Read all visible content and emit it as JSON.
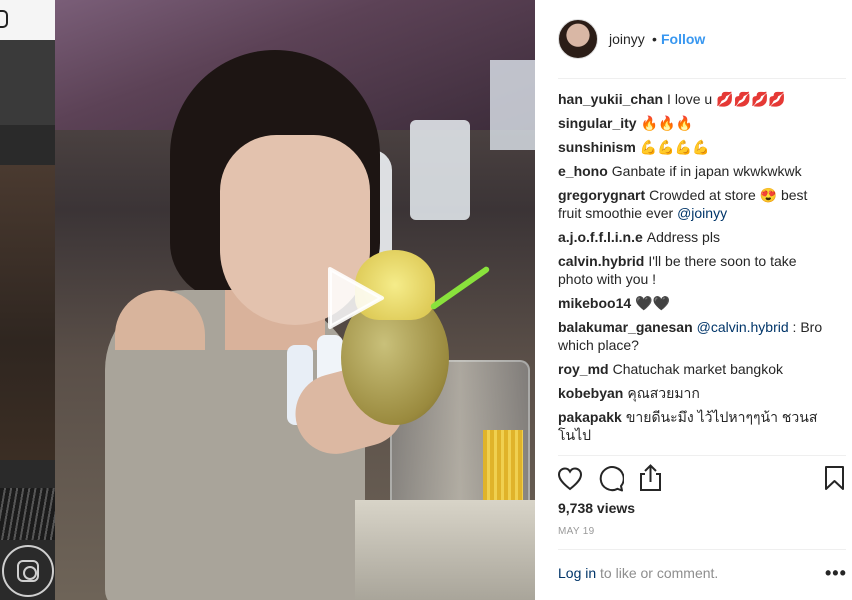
{
  "post": {
    "username": "joinyy",
    "separator": "•",
    "follow_label": "Follow"
  },
  "video": {
    "play_icon": "play-icon"
  },
  "comments": [
    {
      "user": "han_yukii_chan",
      "text": "I love u 💋💋💋💋"
    },
    {
      "user": "singular_ity",
      "text": "🔥🔥🔥"
    },
    {
      "user": "sunshinism",
      "text": "💪💪💪💪"
    },
    {
      "user": "e_hono",
      "text": "Ganbate if in japan wkwkwkwk"
    },
    {
      "user": "gregorygnart",
      "text": "Crowded at store 😍 best fruit smoothie ever",
      "mention": "@joinyy"
    },
    {
      "user": "a.j.o.f.f.l.i.n.e",
      "text": "Address pls"
    },
    {
      "user": "calvin.hybrid",
      "text": "I'll be there soon to take photo with you !"
    },
    {
      "user": "mikeboo14",
      "text": "🖤🖤"
    },
    {
      "user": "balakumar_ganesan",
      "mention": "@calvin.hybrid",
      "text": ": Bro which place?"
    },
    {
      "user": "roy_md",
      "text": "Chatuchak market bangkok"
    },
    {
      "user": "kobebyan",
      "text": "คุณสวยมาก"
    },
    {
      "user": "pakapakk",
      "text": "ขายดีนะมึง ไว้ไปหาๆๆน้า ชวนสโนไป"
    }
  ],
  "actions": {
    "like_icon": "heart-icon",
    "comment_icon": "comment-icon",
    "share_icon": "share-icon",
    "save_icon": "bookmark-icon"
  },
  "stats": {
    "views": "9,738 views",
    "date": "MAY 19"
  },
  "footer": {
    "login_label": "Log in",
    "login_suffix": " to like or comment.",
    "more_label": "•••"
  },
  "colors": {
    "link": "#3897f0",
    "text": "#262626",
    "muted": "#8e8e8e",
    "mention": "#003569"
  }
}
